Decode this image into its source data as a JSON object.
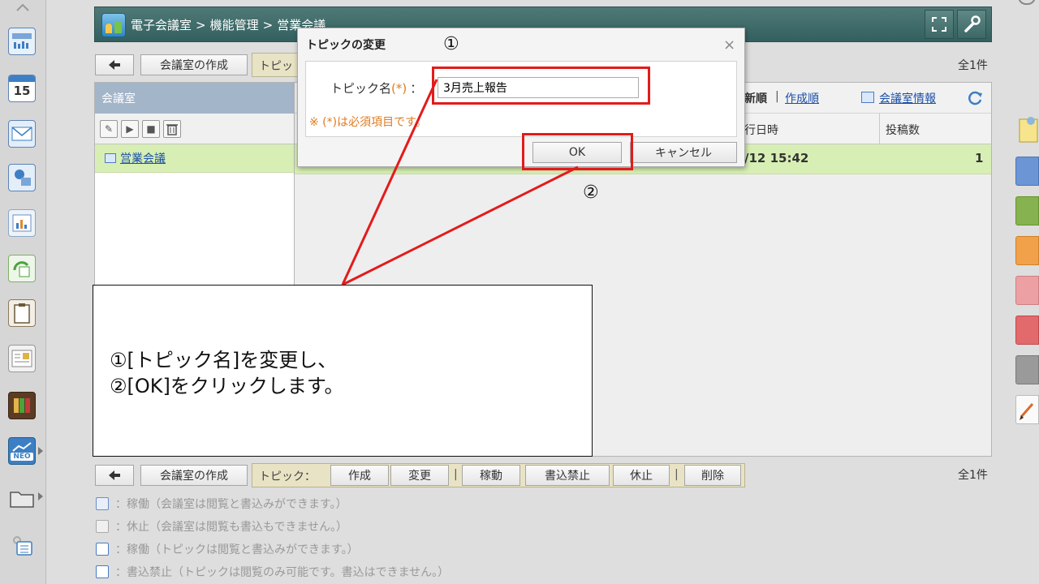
{
  "header": {
    "breadcrumb": [
      "電子会議室",
      "機能管理",
      "営業会議"
    ],
    "breadcrumb_sep": ">",
    "fullscreen_icon": "expand-icon",
    "settings_icon": "wrench-icon"
  },
  "sidebar": {
    "calendar_day": "15",
    "neo_label": "NEO"
  },
  "toolbar_top": {
    "back_icon": "back-arrow-icon",
    "create_room": "会議室の作成",
    "topic_label_partial": "トピッ",
    "count": "全1件"
  },
  "toolbar_bottom": {
    "back_icon": "back-arrow-icon",
    "create_room": "会議室の作成",
    "topic_label": "トピック：",
    "create": "作成",
    "change": "変更",
    "activate": "稼動",
    "no_write": "書込禁止",
    "pause": "休止",
    "delete": "削除",
    "count": "全1件"
  },
  "rooms_panel": {
    "header": "会議室",
    "room_name": "営業会議"
  },
  "topics_panel": {
    "sort_new": "新順",
    "sort_sep": "|",
    "sort_created": "作成順",
    "room_info": "会議室情報",
    "refresh_icon": "refresh-icon",
    "col_datetime_partial": "行日時",
    "col_posts": "投稿数",
    "row_datetime_partial": "/12 15:42",
    "row_posts": "1"
  },
  "dialog": {
    "title": "トピックの変更",
    "close": "×",
    "field_label": "トピック名",
    "required_mark": "(*)",
    "colon": "：",
    "field_value": "3月売上報告",
    "required_note": "※ (*)は必須項目です。",
    "ok": "OK",
    "cancel": "キャンセル"
  },
  "annotations": {
    "marker_1": "①",
    "marker_2": "②",
    "line_1": "①[トピック名]を変更し、",
    "line_2": "②[OK]をクリックします。",
    "highlight_color": "#e31b1b"
  },
  "legend": [
    {
      "icon": "room-active-icon",
      "text": "：稼働（会議室は閲覧と書込みができます。）"
    },
    {
      "icon": "room-paused-icon",
      "text": "：休止（会議室は閲覧も書込もできません。）"
    },
    {
      "icon": "topic-active-icon",
      "text": "：稼働（トピックは閲覧と書込みができます。）"
    },
    {
      "icon": "topic-nowrite-icon",
      "text": "：書込禁止（トピックは閲覧のみ可能です。書込はできません。）"
    }
  ]
}
